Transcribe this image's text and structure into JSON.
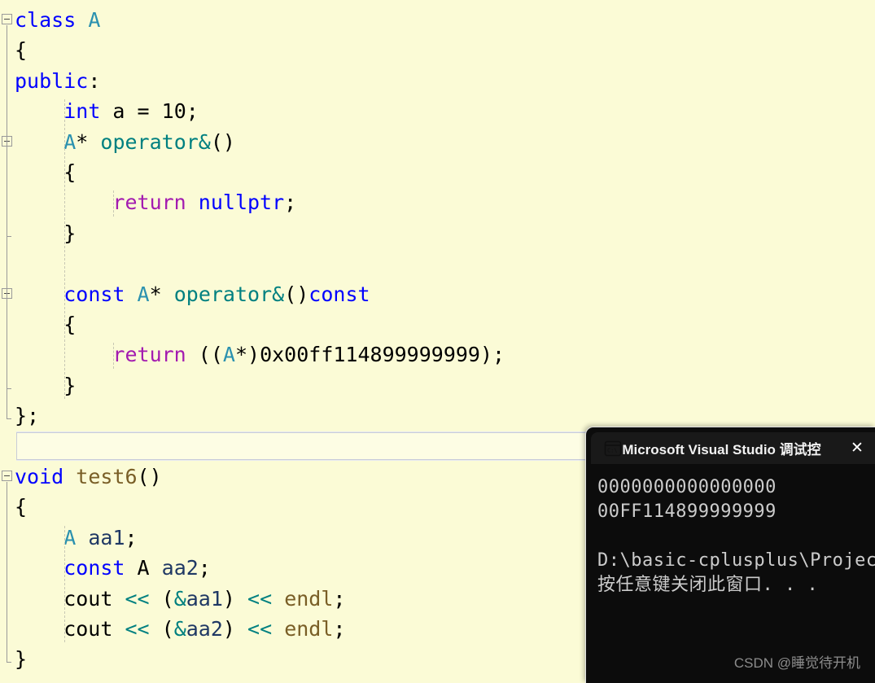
{
  "editor": {
    "background_color": "#fbfbd6",
    "language": "cpp",
    "lines": [
      {
        "n": 1,
        "indent": 0,
        "fold": "start",
        "text": "class A",
        "tokens": [
          {
            "t": "class ",
            "c": "kw"
          },
          {
            "t": "A",
            "c": "typ"
          }
        ]
      },
      {
        "n": 2,
        "indent": 0,
        "text": "{",
        "tokens": [
          {
            "t": "{",
            "c": "pl"
          }
        ]
      },
      {
        "n": 3,
        "indent": 0,
        "text": "public:",
        "tokens": [
          {
            "t": "public",
            "c": "kw"
          },
          {
            "t": ":",
            "c": "pl"
          }
        ]
      },
      {
        "n": 4,
        "indent": 1,
        "text": "    int a = 10;",
        "tokens": [
          {
            "t": "    ",
            "c": "pl"
          },
          {
            "t": "int",
            "c": "kw"
          },
          {
            "t": " a = ",
            "c": "pl"
          },
          {
            "t": "10",
            "c": "num"
          },
          {
            "t": ";",
            "c": "pl"
          }
        ]
      },
      {
        "n": 5,
        "indent": 1,
        "fold": "start",
        "text": "    A* operator&()",
        "tokens": [
          {
            "t": "    ",
            "c": "pl"
          },
          {
            "t": "A",
            "c": "typ"
          },
          {
            "t": "* ",
            "c": "pl"
          },
          {
            "t": "operator&",
            "c": "op"
          },
          {
            "t": "()",
            "c": "pl"
          }
        ]
      },
      {
        "n": 6,
        "indent": 1,
        "text": "    {",
        "tokens": [
          {
            "t": "    {",
            "c": "pl"
          }
        ]
      },
      {
        "n": 7,
        "indent": 2,
        "text": "        return nullptr;",
        "tokens": [
          {
            "t": "        ",
            "c": "pl"
          },
          {
            "t": "return",
            "c": "ret"
          },
          {
            "t": " ",
            "c": "pl"
          },
          {
            "t": "nullptr",
            "c": "kw"
          },
          {
            "t": ";",
            "c": "pl"
          }
        ]
      },
      {
        "n": 8,
        "indent": 1,
        "text": "    }",
        "tokens": [
          {
            "t": "    }",
            "c": "pl"
          }
        ]
      },
      {
        "n": 9,
        "indent": 1,
        "text": "",
        "tokens": []
      },
      {
        "n": 10,
        "indent": 1,
        "fold": "start",
        "text": "    const A* operator&()const",
        "tokens": [
          {
            "t": "    ",
            "c": "pl"
          },
          {
            "t": "const",
            "c": "kw"
          },
          {
            "t": " ",
            "c": "pl"
          },
          {
            "t": "A",
            "c": "typ"
          },
          {
            "t": "* ",
            "c": "pl"
          },
          {
            "t": "operator&",
            "c": "op"
          },
          {
            "t": "()",
            "c": "pl"
          },
          {
            "t": "const",
            "c": "kw"
          }
        ]
      },
      {
        "n": 11,
        "indent": 1,
        "text": "    {",
        "tokens": [
          {
            "t": "    {",
            "c": "pl"
          }
        ]
      },
      {
        "n": 12,
        "indent": 2,
        "text": "        return ((A*)0x00ff114899999999);",
        "tokens": [
          {
            "t": "        ",
            "c": "pl"
          },
          {
            "t": "return",
            "c": "ret"
          },
          {
            "t": " ((",
            "c": "pl"
          },
          {
            "t": "A",
            "c": "typ"
          },
          {
            "t": "*)",
            "c": "pl"
          },
          {
            "t": "0x00ff114899999999",
            "c": "num"
          },
          {
            "t": ");",
            "c": "pl"
          }
        ]
      },
      {
        "n": 13,
        "indent": 1,
        "text": "    }",
        "tokens": [
          {
            "t": "    }",
            "c": "pl"
          }
        ]
      },
      {
        "n": 14,
        "indent": 0,
        "text": "};",
        "tokens": [
          {
            "t": "};",
            "c": "pl"
          }
        ]
      },
      {
        "n": 15,
        "indent": 0,
        "current": true,
        "text": "",
        "tokens": []
      },
      {
        "n": 16,
        "indent": 0,
        "fold": "start",
        "text": "void test6()",
        "tokens": [
          {
            "t": "void",
            "c": "kw"
          },
          {
            "t": " ",
            "c": "pl"
          },
          {
            "t": "test6",
            "c": "fn"
          },
          {
            "t": "()",
            "c": "pl"
          }
        ]
      },
      {
        "n": 17,
        "indent": 0,
        "text": "{",
        "tokens": [
          {
            "t": "{",
            "c": "pl"
          }
        ]
      },
      {
        "n": 18,
        "indent": 1,
        "text": "    A aa1;",
        "tokens": [
          {
            "t": "    ",
            "c": "pl"
          },
          {
            "t": "A",
            "c": "typ"
          },
          {
            "t": " ",
            "c": "pl"
          },
          {
            "t": "aa1",
            "c": "var"
          },
          {
            "t": ";",
            "c": "pl"
          }
        ]
      },
      {
        "n": 19,
        "indent": 1,
        "text": "    const A aa2;",
        "tokens": [
          {
            "t": "    ",
            "c": "pl"
          },
          {
            "t": "const",
            "c": "kw"
          },
          {
            "t": " A ",
            "c": "pl"
          },
          {
            "t": "aa2",
            "c": "var"
          },
          {
            "t": ";",
            "c": "pl"
          }
        ]
      },
      {
        "n": 20,
        "indent": 1,
        "text": "    cout << (&aa1) << endl;",
        "tokens": [
          {
            "t": "    cout ",
            "c": "pl"
          },
          {
            "t": "<<",
            "c": "op"
          },
          {
            "t": " (",
            "c": "pl"
          },
          {
            "t": "&",
            "c": "op"
          },
          {
            "t": "aa1",
            "c": "var"
          },
          {
            "t": ") ",
            "c": "pl"
          },
          {
            "t": "<<",
            "c": "op"
          },
          {
            "t": " ",
            "c": "pl"
          },
          {
            "t": "endl",
            "c": "fn"
          },
          {
            "t": ";",
            "c": "pl"
          }
        ]
      },
      {
        "n": 21,
        "indent": 1,
        "text": "    cout << (&aa2) << endl;",
        "tokens": [
          {
            "t": "    cout ",
            "c": "pl"
          },
          {
            "t": "<<",
            "c": "op"
          },
          {
            "t": " (",
            "c": "pl"
          },
          {
            "t": "&",
            "c": "op"
          },
          {
            "t": "aa2",
            "c": "var"
          },
          {
            "t": ") ",
            "c": "pl"
          },
          {
            "t": "<<",
            "c": "op"
          },
          {
            "t": " ",
            "c": "pl"
          },
          {
            "t": "endl",
            "c": "fn"
          },
          {
            "t": ";",
            "c": "pl"
          }
        ]
      },
      {
        "n": 22,
        "indent": 0,
        "text": "}",
        "tokens": [
          {
            "t": "}",
            "c": "pl"
          }
        ]
      }
    ]
  },
  "console": {
    "title": "Microsoft Visual Studio 调试控",
    "close_label": "✕",
    "icon_name": "cmd-prompt-icon",
    "background_color": "#0c0c0c",
    "titlebar_color": "#191919",
    "output_lines": [
      "0000000000000000",
      "00FF114899999999",
      "",
      "D:\\basic-cplusplus\\Projec",
      "按任意键关闭此窗口. . ."
    ]
  },
  "watermark": {
    "text": "CSDN @睡觉待开机"
  }
}
